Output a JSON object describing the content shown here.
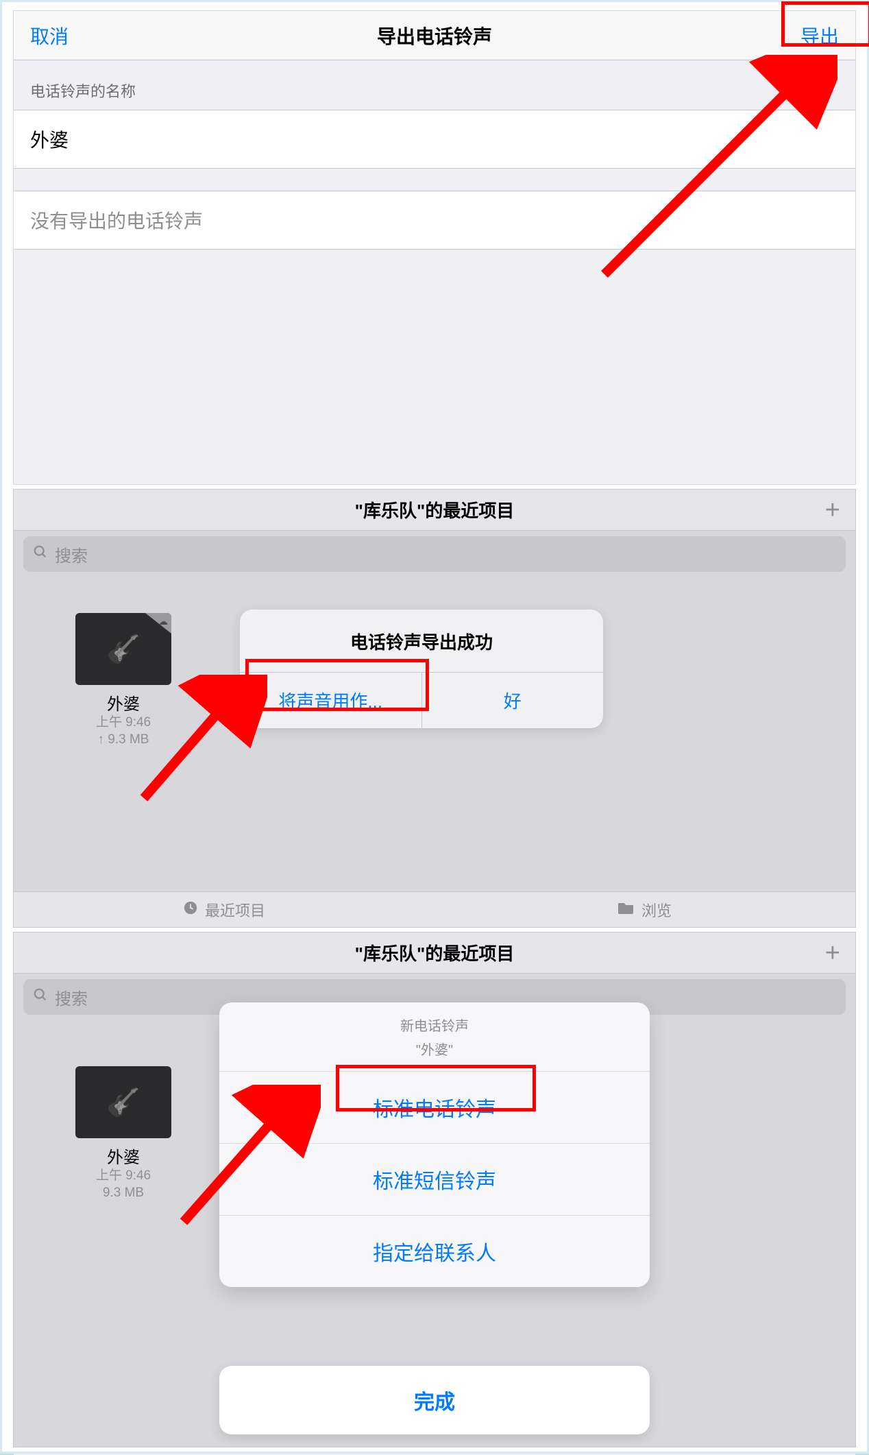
{
  "panel1": {
    "cancel": "取消",
    "title": "导出电话铃声",
    "export": "导出",
    "name_section_header": "电话铃声的名称",
    "ringtone_name": "外婆",
    "empty_text": "没有导出的电话铃声"
  },
  "panel2": {
    "title": "\"库乐队\"的最近项目",
    "search_placeholder": "搜索",
    "item": {
      "name": "外婆",
      "time": "上午 9:46",
      "size": "↑ 9.3 MB"
    },
    "alert": {
      "message": "电话铃声导出成功",
      "use_as": "将声音用作...",
      "ok": "好"
    },
    "tabs": {
      "recents": "最近项目",
      "browse": "浏览"
    }
  },
  "panel3": {
    "title": "\"库乐队\"的最近项目",
    "search_placeholder": "搜索",
    "item": {
      "name": "外婆",
      "time": "上午 9:46",
      "size": "9.3 MB"
    },
    "sheet": {
      "header": "新电话铃声",
      "sub": "\"外婆\"",
      "opt1": "标准电话铃声",
      "opt2": "标准短信铃声",
      "opt3": "指定给联系人"
    },
    "done": "完成"
  }
}
